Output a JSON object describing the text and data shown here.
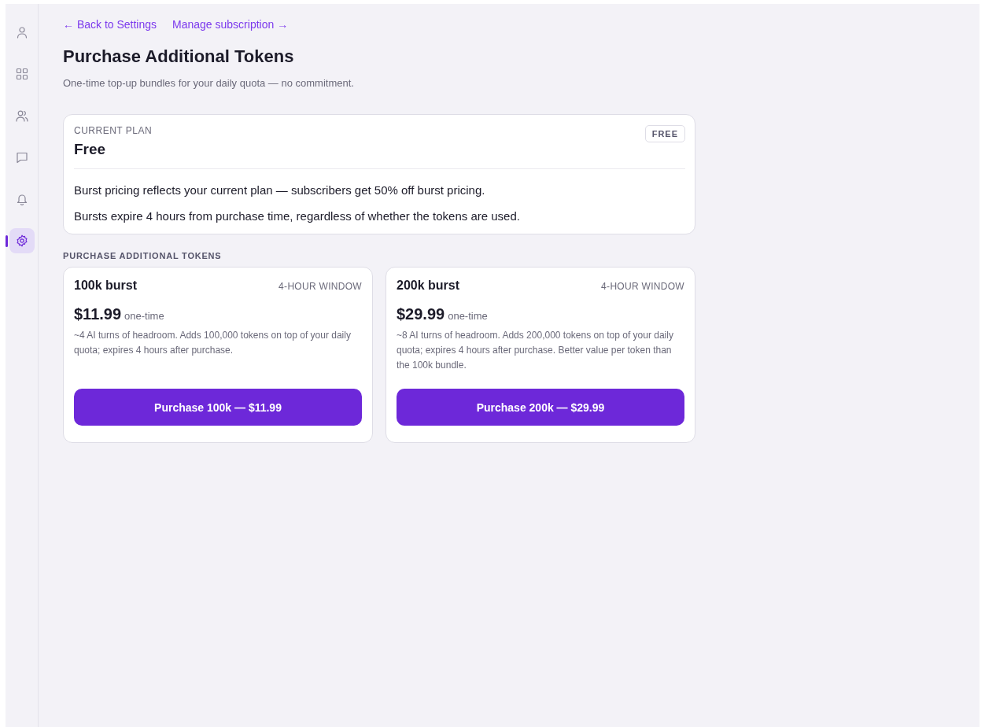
{
  "sidebar": {
    "items": [
      {
        "kind": "user",
        "selected": false
      },
      {
        "kind": "grid",
        "selected": false
      },
      {
        "kind": "users",
        "selected": false
      },
      {
        "kind": "chat",
        "selected": false
      },
      {
        "kind": "bell",
        "selected": false
      },
      {
        "kind": "settings",
        "selected": true
      }
    ]
  },
  "links": [
    {
      "label": "← Back to Settings"
    },
    {
      "label": "Manage subscription →"
    }
  ],
  "title": "Purchase Additional Tokens",
  "subtitle": "One-time top-up bundles for your daily quota — no commitment.",
  "plan_card": {
    "label": "CURRENT PLAN",
    "name": "Free",
    "badge": "FREE",
    "notes": [
      "Burst pricing reflects your current plan — subscribers get 50% off burst pricing.",
      "Bursts expire 4 hours from purchase time, regardless of whether the tokens are used."
    ]
  },
  "section_title": "PURCHASE ADDITIONAL TOKENS",
  "bundles": [
    {
      "name": "100k burst",
      "window": "4-HOUR WINDOW",
      "price": "$11.99",
      "price_note": "one-time",
      "description": "~4 AI turns of headroom. Adds 100,000 tokens on top of your daily quota; expires 4 hours after purchase.",
      "button": "Purchase 100k — $11.99"
    },
    {
      "name": "200k burst",
      "window": "4-HOUR WINDOW",
      "price": "$29.99",
      "price_note": "one-time",
      "description": "~8 AI turns of headroom. Adds 200,000 tokens on top of your daily quota; expires 4 hours after purchase. Better value per token than the 100k bundle.",
      "button": "Purchase 200k — $29.99"
    }
  ]
}
